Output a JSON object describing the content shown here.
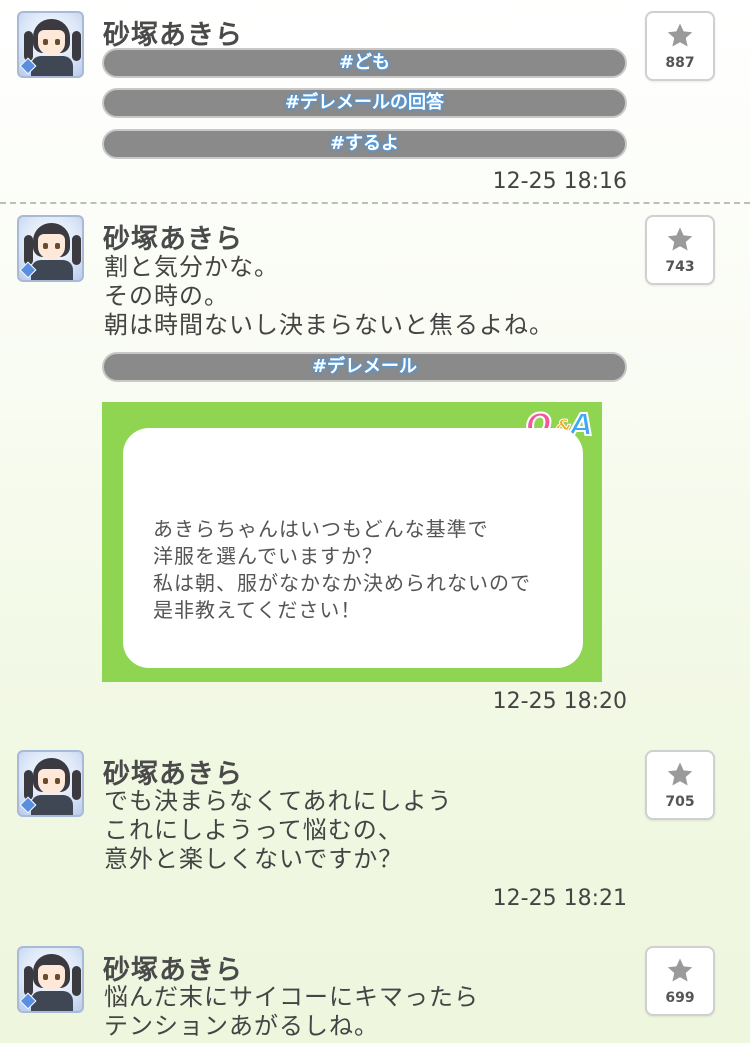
{
  "posts": [
    {
      "name": "砂塚あきら",
      "likes": "887",
      "tags": [
        "#ども",
        "#デレメールの回答",
        "#するよ"
      ],
      "time": "12-25 18:16"
    },
    {
      "name": "砂塚あきら",
      "likes": "743",
      "lines": [
        "割と気分かな。",
        "その時の。",
        "朝は時間ないし決まらないと焦るよね。"
      ],
      "tags": [
        "#デレメール"
      ],
      "qa": {
        "logo_q": "Q",
        "logo_amp": "&",
        "logo_a": "A",
        "lines": [
          "あきらちゃんはいつもどんな基準で",
          "洋服を選んでいますか？",
          "私は朝、服がなかなか決められないので",
          "是非教えてください！"
        ]
      },
      "time": "12-25 18:20"
    },
    {
      "name": "砂塚あきら",
      "likes": "705",
      "lines": [
        "でも決まらなくてあれにしよう",
        "これにしようって悩むの、",
        "意外と楽しくないですか？"
      ],
      "time": "12-25 18:21"
    },
    {
      "name": "砂塚あきら",
      "likes": "699",
      "lines": [
        "悩んだ末にサイコーにキマったら",
        "テンションあがるしね。"
      ]
    }
  ],
  "colors": {
    "tag_bg": "#8a8a8a",
    "tag_glow": "#4a9be8",
    "qa_frame": "#8fd551",
    "star": "#9a9a9a"
  },
  "icons": {
    "like": "star-icon",
    "avatar_badge": "diamond-icon"
  }
}
